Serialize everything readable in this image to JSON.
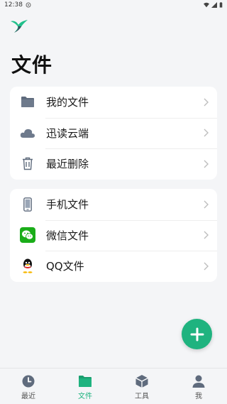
{
  "status_bar": {
    "time": "12:38"
  },
  "page": {
    "title": "文件"
  },
  "card1": {
    "items": [
      {
        "label": "我的文件",
        "icon": "folder-icon"
      },
      {
        "label": "迅读云端",
        "icon": "cloud-icon"
      },
      {
        "label": "最近删除",
        "icon": "trash-icon"
      }
    ]
  },
  "card2": {
    "items": [
      {
        "label": "手机文件",
        "icon": "phone-icon"
      },
      {
        "label": "微信文件",
        "icon": "wechat-icon"
      },
      {
        "label": "QQ文件",
        "icon": "qq-icon"
      }
    ]
  },
  "fab": {
    "icon": "plus-icon"
  },
  "bottom_nav": {
    "items": [
      {
        "label": "最近",
        "icon": "clock-icon"
      },
      {
        "label": "文件",
        "icon": "folder-icon"
      },
      {
        "label": "工具",
        "icon": "box-icon"
      },
      {
        "label": "我",
        "icon": "person-icon"
      }
    ],
    "active": "文件"
  },
  "colors": {
    "accent": "#1fb37f",
    "background": "#f4f5f7",
    "card": "#ffffff"
  }
}
